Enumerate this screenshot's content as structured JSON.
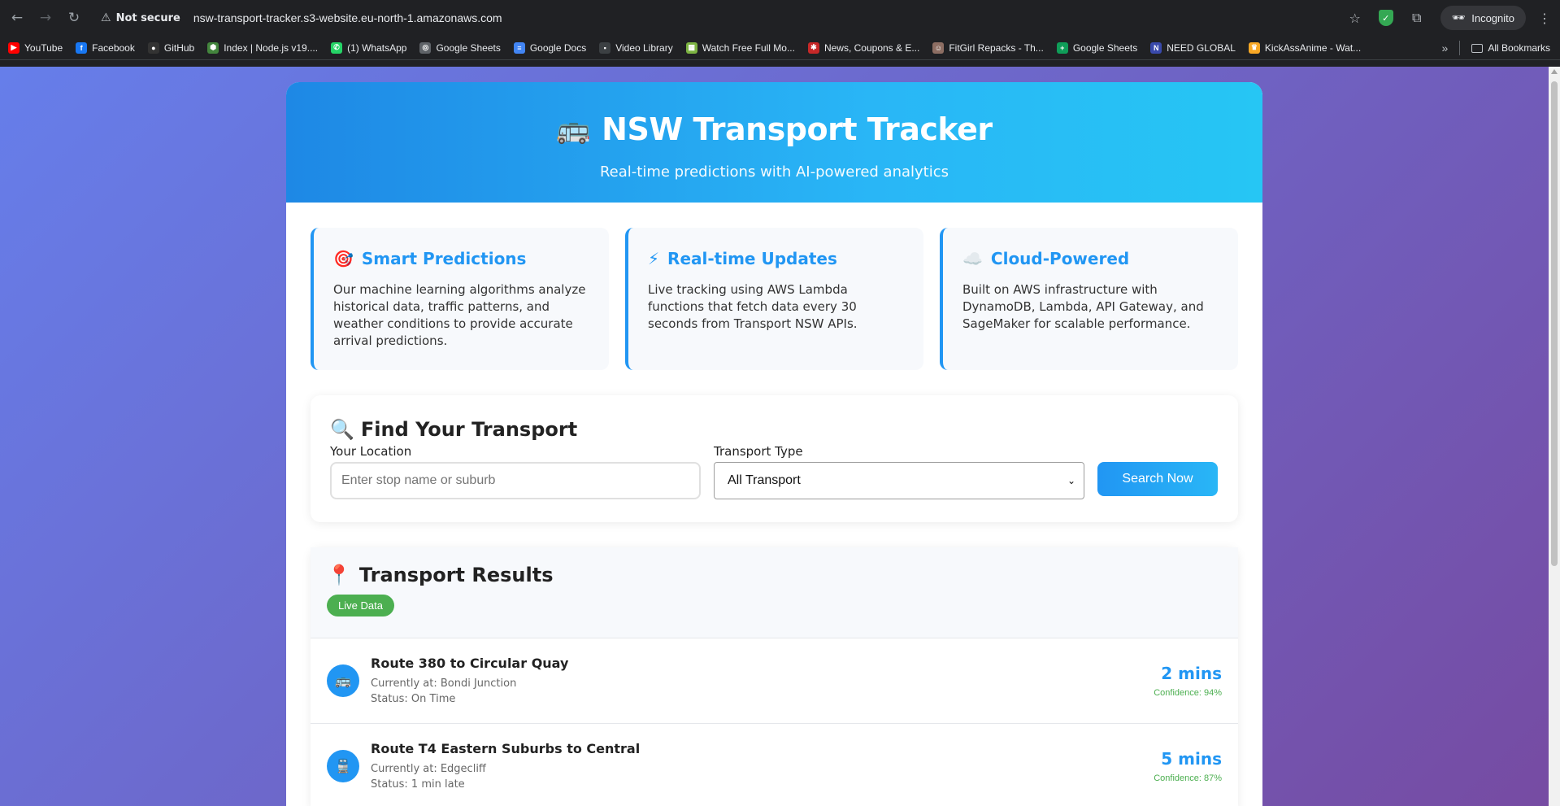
{
  "browser": {
    "security_label": "Not secure",
    "url": "nsw-transport-tracker.s3-website.eu-north-1.amazonaws.com",
    "incognito_label": "Incognito",
    "bookmarks": [
      {
        "label": "YouTube",
        "color": "#ff0000",
        "glyph": "▶"
      },
      {
        "label": "Facebook",
        "color": "#1877f2",
        "glyph": "f"
      },
      {
        "label": "GitHub",
        "color": "#333333",
        "glyph": "●"
      },
      {
        "label": "Index | Node.js v19....",
        "color": "#43853d",
        "glyph": "⬢"
      },
      {
        "label": "(1) WhatsApp",
        "color": "#25d366",
        "glyph": "✆"
      },
      {
        "label": "Google Sheets",
        "color": "#5f6368",
        "glyph": "◎"
      },
      {
        "label": "Google Docs",
        "color": "#4285f4",
        "glyph": "≡"
      },
      {
        "label": "Video Library",
        "color": "#3c4043",
        "glyph": "▪"
      },
      {
        "label": "Watch Free Full Mo...",
        "color": "#7cb342",
        "glyph": "▦"
      },
      {
        "label": "News, Coupons & E...",
        "color": "#c62828",
        "glyph": "✱"
      },
      {
        "label": "FitGirl Repacks - Th...",
        "color": "#8d6e63",
        "glyph": "☺"
      },
      {
        "label": "Google Sheets",
        "color": "#0f9d58",
        "glyph": "+"
      },
      {
        "label": "NEED GLOBAL",
        "color": "#3949ab",
        "glyph": "N"
      },
      {
        "label": "KickAssAnime - Wat...",
        "color": "#f9a825",
        "glyph": "♛"
      }
    ],
    "all_bookmarks_label": "All Bookmarks"
  },
  "hero": {
    "icon": "🚌",
    "title": "NSW Transport Tracker",
    "subtitle": "Real-time predictions with AI-powered analytics"
  },
  "features": [
    {
      "icon": "🎯",
      "title": "Smart Predictions",
      "text": "Our machine learning algorithms analyze historical data, traffic patterns, and weather conditions to provide accurate arrival predictions."
    },
    {
      "icon": "⚡",
      "title": "Real-time Updates",
      "text": "Live tracking using AWS Lambda functions that fetch data every 30 seconds from Transport NSW APIs."
    },
    {
      "icon": "☁️",
      "title": "Cloud-Powered",
      "text": "Built on AWS infrastructure with DynamoDB, Lambda, API Gateway, and SageMaker for scalable performance."
    }
  ],
  "search": {
    "icon": "🔍",
    "title": "Find Your Transport",
    "location_label": "Your Location",
    "location_placeholder": "Enter stop name or suburb",
    "type_label": "Transport Type",
    "type_selected": "All Transport",
    "button_label": "Search Now"
  },
  "results": {
    "icon": "📍",
    "title": "Transport Results",
    "badge": "Live Data",
    "items": [
      {
        "icon": "🚌",
        "title": "Route 380 to Circular Quay",
        "location": "Currently at: Bondi Junction",
        "status": "Status: On Time",
        "eta": "2 mins",
        "confidence": "Confidence: 94%"
      },
      {
        "icon": "🚆",
        "title": "Route T4 Eastern Suburbs to Central",
        "location": "Currently at: Edgecliff",
        "status": "Status: 1 min late",
        "eta": "5 mins",
        "confidence": "Confidence: 87%"
      }
    ]
  }
}
